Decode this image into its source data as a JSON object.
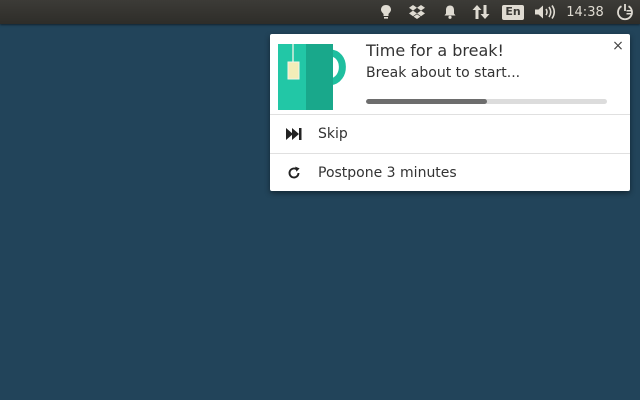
{
  "panel": {
    "language": "En",
    "clock": "14:38"
  },
  "notification": {
    "title": "Time for a break!",
    "body": "Break about to start...",
    "progress": 0.5,
    "close_label": "×",
    "actions": [
      {
        "label": "Skip",
        "icon": "skip-forward-icon"
      },
      {
        "label": "Postpone 3 minutes",
        "icon": "refresh-icon"
      }
    ],
    "image_icon": "teacup-icon"
  },
  "colors": {
    "desktop": "#22445a",
    "panel": "#3c3b37",
    "mug": "#1fbf9f",
    "mug_dark": "#19a88b"
  }
}
